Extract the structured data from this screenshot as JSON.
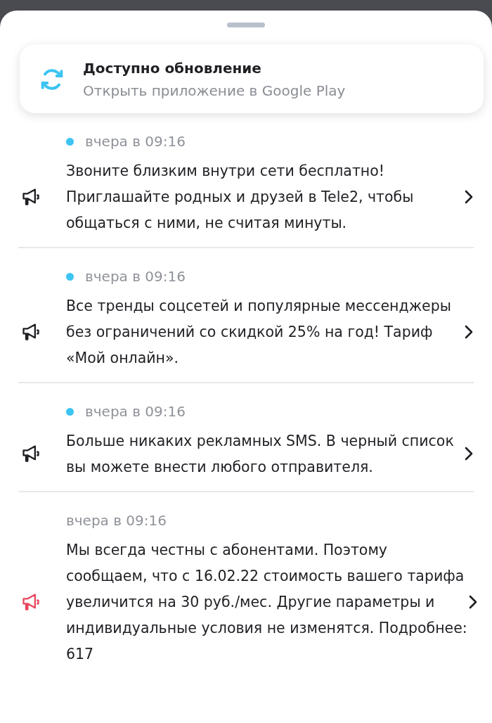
{
  "update_card": {
    "title": "Доступно обновление",
    "subtitle": "Открыть приложение в Google Play"
  },
  "notifications": [
    {
      "time": "вчера в 09:16",
      "unread": true,
      "color": "#1f1f24",
      "text": "Звоните близким внутри сети бесплатно! Приглашайте родных и друзей в Tele2, чтобы общаться с ними, не считая минуты."
    },
    {
      "time": "вчера в 09:16",
      "unread": true,
      "color": "#1f1f24",
      "text": "Все тренды соцсетей и популярные мессенджеры без ограничений со скидкой 25% на год! Тариф «Мой онлайн»."
    },
    {
      "time": "вчера в 09:16",
      "unread": true,
      "color": "#1f1f24",
      "text": "Больше никаких рекламных SMS. В черный список вы можете внести любого отправителя."
    },
    {
      "time": "вчера в 09:16",
      "unread": false,
      "color": "#e8475f",
      "text": "Мы всегда честны с абонентами. Поэтому сообщаем, что с 16.02.22 стоимость вашего тарифа увеличится на  30 руб./мес. Другие параметры и индивидуальные условия не изменятся. Подробнее: 617"
    }
  ]
}
